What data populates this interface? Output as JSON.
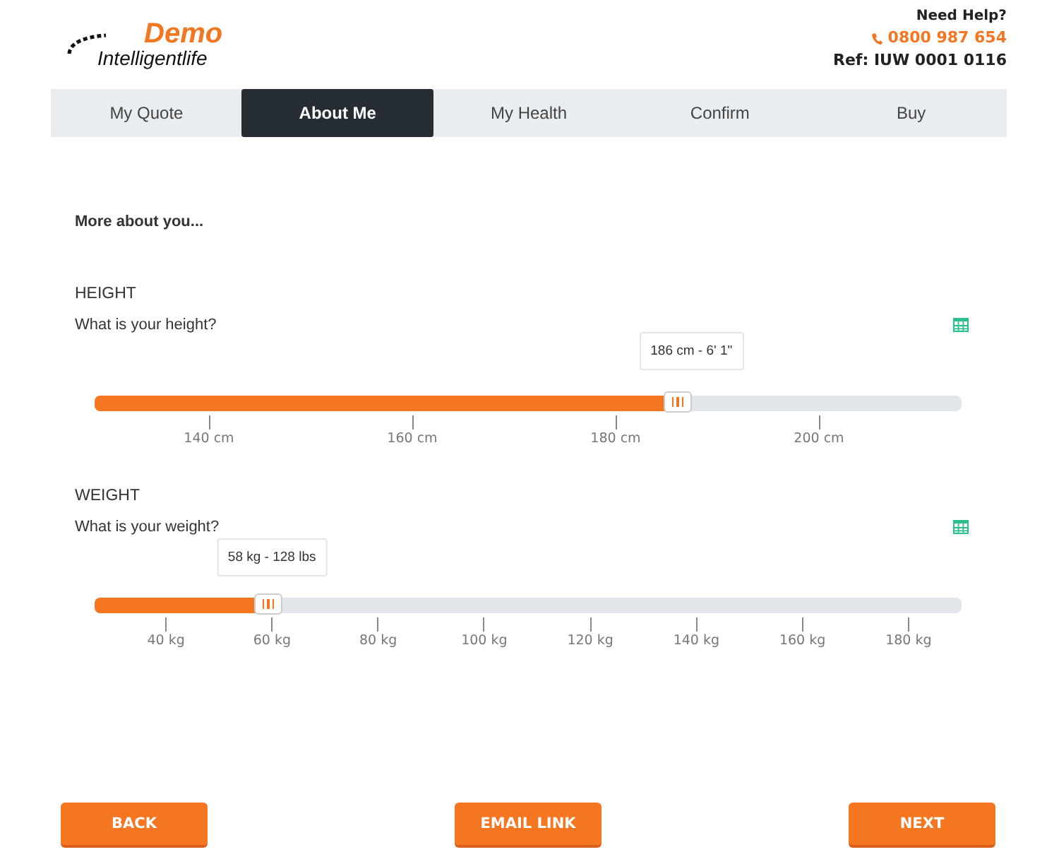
{
  "logo": {
    "brand": "Demo",
    "name": "Intelligentlife"
  },
  "help": {
    "title": "Need Help?",
    "phone": "0800 987 654",
    "ref": "Ref: IUW 0001 0116"
  },
  "tabs": [
    {
      "label": "My Quote",
      "selected": false
    },
    {
      "label": "About Me",
      "selected": true
    },
    {
      "label": "My Health",
      "selected": false
    },
    {
      "label": "Confirm",
      "selected": false
    },
    {
      "label": "Buy",
      "selected": false
    }
  ],
  "intro": "More about you...",
  "sliders": [
    {
      "kind": "height",
      "heading": "HEIGHT",
      "question": "What is your height?",
      "reading": "186 cm - 6' 1\"",
      "level": 0.673,
      "ticks": [
        "140 cm",
        "160 cm",
        "180 cm",
        "200 cm"
      ]
    },
    {
      "kind": "weight",
      "heading": "WEIGHT",
      "question": "What is your weight?",
      "reading": "58 kg - 128 lbs",
      "level": 0.2,
      "ticks": [
        "40 kg",
        "60 kg",
        "80 kg",
        "100 kg",
        "120 kg",
        "140 kg",
        "160 kg",
        "180 kg"
      ]
    }
  ],
  "buttons": [
    "BACK",
    "EMAIL LINK",
    "NEXT"
  ]
}
